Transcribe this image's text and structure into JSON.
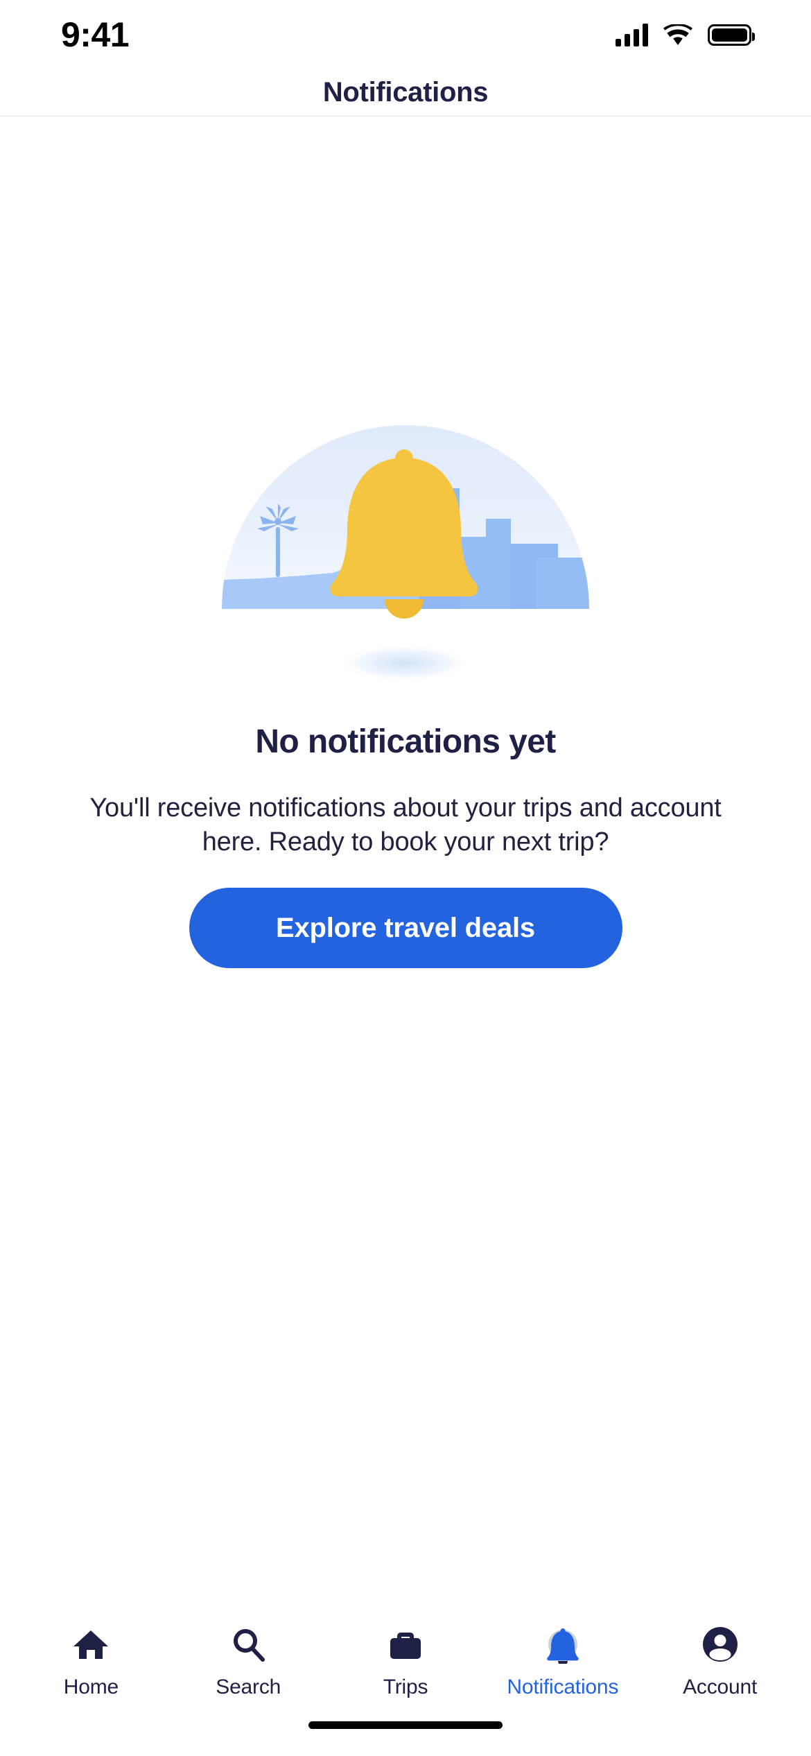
{
  "status_bar": {
    "time": "9:41",
    "cellular_icon": "signal-bars-icon",
    "wifi_icon": "wifi-icon",
    "battery_icon": "battery-full-icon"
  },
  "header": {
    "title": "Notifications"
  },
  "empty_state": {
    "illustration_name": "bell-city-skyline-illustration",
    "title": "No notifications yet",
    "body": "You'll receive notifications about your trips and account here. Ready to book your next trip?",
    "cta_label": "Explore travel deals"
  },
  "tab_bar": {
    "items": [
      {
        "label": "Home",
        "icon": "home-icon",
        "active": false
      },
      {
        "label": "Search",
        "icon": "search-icon",
        "active": false
      },
      {
        "label": "Trips",
        "icon": "briefcase-icon",
        "active": false
      },
      {
        "label": "Notifications",
        "icon": "bell-icon",
        "active": true
      },
      {
        "label": "Account",
        "icon": "person-circle-icon",
        "active": false
      }
    ]
  },
  "colors": {
    "accent_blue": "#2463e0",
    "text_navy": "#1f2045",
    "bell_yellow": "#f5c542",
    "skyline_blue": "#94bdf5",
    "sky_light": "#e4edfb",
    "divider": "#e8e8ee",
    "inactive_icon": "#1f2045"
  }
}
